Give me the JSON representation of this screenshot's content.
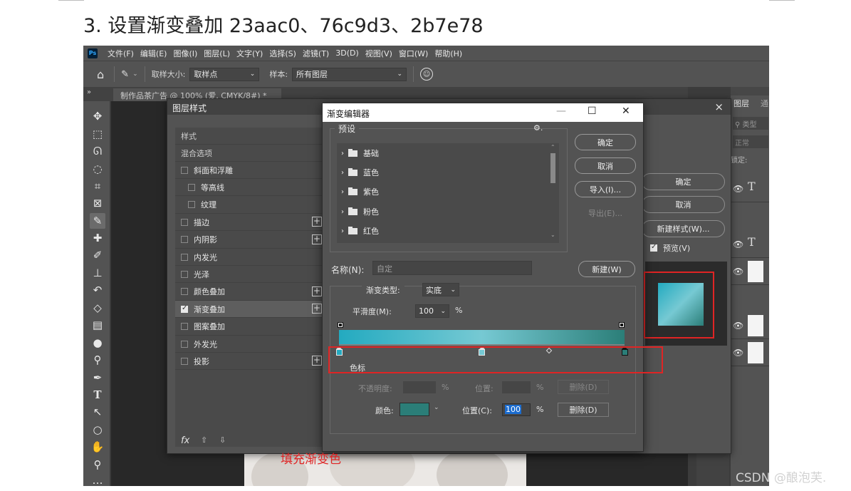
{
  "doc_title": "3.  设置渐变叠加 23aac0、76c9d3、2b7e78",
  "watermark": "CSDN @酿泡芙.",
  "annotation": "填充渐变色",
  "colors": {
    "stop1": "#23aac0",
    "stop2": "#76c9d3",
    "stop3": "#2b7e78",
    "highlight": "#e02424"
  },
  "ps": {
    "logo": "Ps",
    "menu": [
      "文件(F)",
      "编辑(E)",
      "图像(I)",
      "图层(L)",
      "文字(Y)",
      "选择(S)",
      "滤镜(T)",
      "3D(D)",
      "视图(V)",
      "窗口(W)",
      "帮助(H)"
    ],
    "options": {
      "sample_size_label": "取样大小:",
      "sample_size_value": "取样点",
      "sample_label": "样本:",
      "sample_value": "所有图层"
    },
    "doc_tab": "制作品茶广告 @ 100% (爱, CMYK/8#) *",
    "tab_close": "×",
    "collapse_left": "»",
    "collapse_right": "« «",
    "tools": [
      "move-icon",
      "marquee-icon",
      "lasso-icon",
      "quick-select-icon",
      "crop-icon",
      "frame-icon",
      "eyedropper-icon",
      "healing-icon",
      "brush-icon",
      "stamp-icon",
      "history-brush-icon",
      "eraser-icon",
      "gradient-icon",
      "blur-icon",
      "dodge-icon",
      "pen-icon",
      "type-icon",
      "path-select-icon",
      "ellipse-icon",
      "hand-icon",
      "zoom-icon",
      "more-icon"
    ],
    "right_panel": {
      "tab_layers": "图层",
      "tab_other": "通",
      "search_placeholder": "类型",
      "blend_mode": "正常",
      "lock_label": "锁定:"
    }
  },
  "layer_style": {
    "title": "图层样式",
    "close": "×",
    "list_header": "样式",
    "blend_options": "混合选项",
    "items": [
      {
        "label": "斜面和浮雕",
        "checked": false,
        "plus": false,
        "indent": false
      },
      {
        "label": "等高线",
        "checked": false,
        "plus": false,
        "indent": true
      },
      {
        "label": "纹理",
        "checked": false,
        "plus": false,
        "indent": true
      },
      {
        "label": "描边",
        "checked": false,
        "plus": true,
        "indent": false
      },
      {
        "label": "内阴影",
        "checked": false,
        "plus": true,
        "indent": false
      },
      {
        "label": "内发光",
        "checked": false,
        "plus": false,
        "indent": false
      },
      {
        "label": "光泽",
        "checked": false,
        "plus": false,
        "indent": false
      },
      {
        "label": "颜色叠加",
        "checked": false,
        "plus": true,
        "indent": false
      },
      {
        "label": "渐变叠加",
        "checked": true,
        "plus": true,
        "indent": false
      },
      {
        "label": "图案叠加",
        "checked": false,
        "plus": false,
        "indent": false
      },
      {
        "label": "外发光",
        "checked": false,
        "plus": false,
        "indent": false
      },
      {
        "label": "投影",
        "checked": false,
        "plus": true,
        "indent": false
      }
    ],
    "footer_fx": "fx",
    "ok": "确定",
    "cancel": "取消",
    "new_style": "新建样式(W)...",
    "preview_label": "预览(V)"
  },
  "gradient_editor": {
    "title": "渐变编辑器",
    "minimize": "—",
    "maximize": "☐",
    "close": "✕",
    "presets_label": "预设",
    "presets": [
      "基础",
      "蓝色",
      "紫色",
      "粉色",
      "红色"
    ],
    "ok": "确定",
    "cancel": "取消",
    "import": "导入(I)...",
    "export": "导出(E)...",
    "name_label": "名称(N):",
    "name_value": "自定",
    "new": "新建(W)",
    "type_label": "渐变类型:",
    "type_value": "实底",
    "smooth_label": "平滑度(M):",
    "smooth_value": "100",
    "smooth_unit": "%",
    "stops_label": "色标",
    "opacity_label": "不透明度:",
    "opacity_unit": "%",
    "location_label": "位置:",
    "location_unit": "%",
    "delete_label": "删除(D)",
    "color_label": "颜色:",
    "color_location_label": "位置(C):",
    "color_location_value": "100",
    "color_location_unit": "%",
    "color_delete": "删除(D)",
    "selected_color": "#2b7e78",
    "color_stops": [
      {
        "color": "#23aac0",
        "location": 0
      },
      {
        "color": "#76c9d3",
        "location": 50
      },
      {
        "color": "#2b7e78",
        "location": 100
      }
    ]
  }
}
